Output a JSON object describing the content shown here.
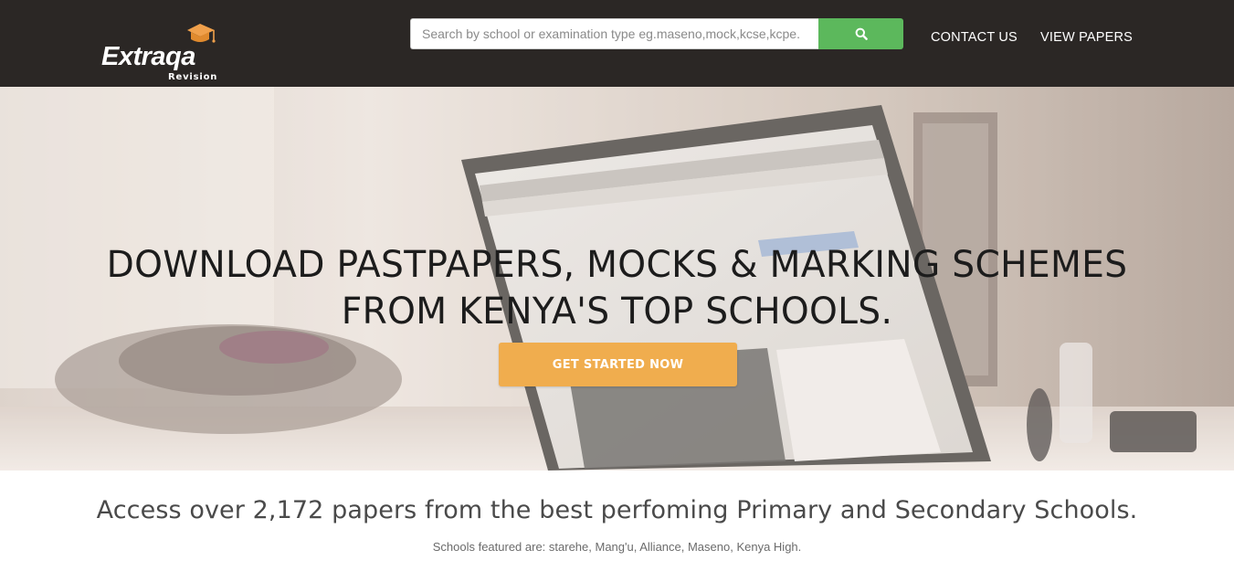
{
  "brand": {
    "name": "Extraqa",
    "sub": "Revision",
    "colors": {
      "cap": "#f0a04b",
      "nav_bg": "#2b2725",
      "search_btn": "#5cb85c",
      "cta": "#f0ad4e"
    }
  },
  "search": {
    "placeholder": "Search by school or examination type eg.maseno,mock,kcse,kcpe.",
    "value": "",
    "button_icon": "search-icon"
  },
  "nav": {
    "links": [
      {
        "label": "CONTACT US"
      },
      {
        "label": "VIEW PAPERS"
      }
    ]
  },
  "hero": {
    "title_line1": "DOWNLOAD PASTPAPERS, MOCKS & MARKING SCHEMES",
    "title_line2": "FROM KENYA'S TOP SCHOOLS.",
    "cta_label": "GET STARTED NOW"
  },
  "info": {
    "tagline": "Access over 2,172 papers from the best perfoming Primary and Secondary Schools.",
    "featured": "Schools featured are: starehe, Mang'u, Alliance, Maseno, Kenya High."
  }
}
